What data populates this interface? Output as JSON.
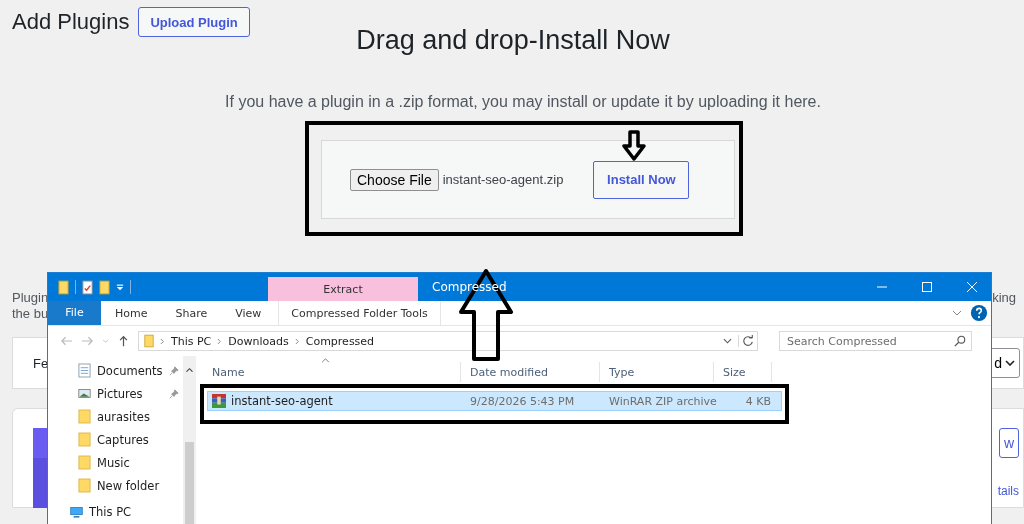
{
  "page": {
    "title": "Add Plugins",
    "upload_button": "Upload Plugin",
    "heading": "Drag and drop-Install Now",
    "description": "If you have a plugin in a .zip format, you may install or update it by uploading it here.",
    "choose_file_button": "Choose File",
    "file_name": "instant-seo-agent.zip",
    "install_button": "Install Now"
  },
  "behind_window": {
    "notice_lines": [
      "Plugin",
      "the bu"
    ],
    "notice_end": "king",
    "filter_tab": "Fe",
    "sort_dropdown": "d",
    "card_picture": {
      "kind": "picture"
    },
    "card_button": "w",
    "card_link": "tails"
  },
  "explorer": {
    "title": "Compressed",
    "context_header": "Extract",
    "tabs": [
      {
        "label": "File",
        "selected": true,
        "kind": "file"
      },
      {
        "label": "Home",
        "selected": false,
        "kind": "tab"
      },
      {
        "label": "Share",
        "selected": false,
        "kind": "tab"
      },
      {
        "label": "View",
        "selected": false,
        "kind": "tab"
      },
      {
        "label": "Compressed Folder Tools",
        "selected": false,
        "kind": "context"
      }
    ],
    "breadcrumb": [
      "This PC",
      "Downloads",
      "Compressed"
    ],
    "search": {
      "placeholder": "Search Compressed"
    },
    "nav_items": [
      {
        "label": "Documents",
        "kind": "documents",
        "pinned": true
      },
      {
        "label": "Pictures",
        "kind": "pictures",
        "pinned": true
      },
      {
        "label": "aurasites",
        "kind": "folder",
        "pinned": false
      },
      {
        "label": "Captures",
        "kind": "folder",
        "pinned": false
      },
      {
        "label": "Music",
        "kind": "folder",
        "pinned": false
      },
      {
        "label": "New folder",
        "kind": "folder",
        "pinned": false
      },
      {
        "label": "This PC",
        "kind": "pc",
        "pinned": false
      }
    ],
    "columns": [
      "Name",
      "Date modified",
      "Type",
      "Size"
    ],
    "files": [
      {
        "name": "instant-seo-agent",
        "date": "9/28/2026 5:43 PM",
        "type": "WinRAR ZIP archive",
        "size": "4 KB",
        "selected": true
      }
    ]
  }
}
